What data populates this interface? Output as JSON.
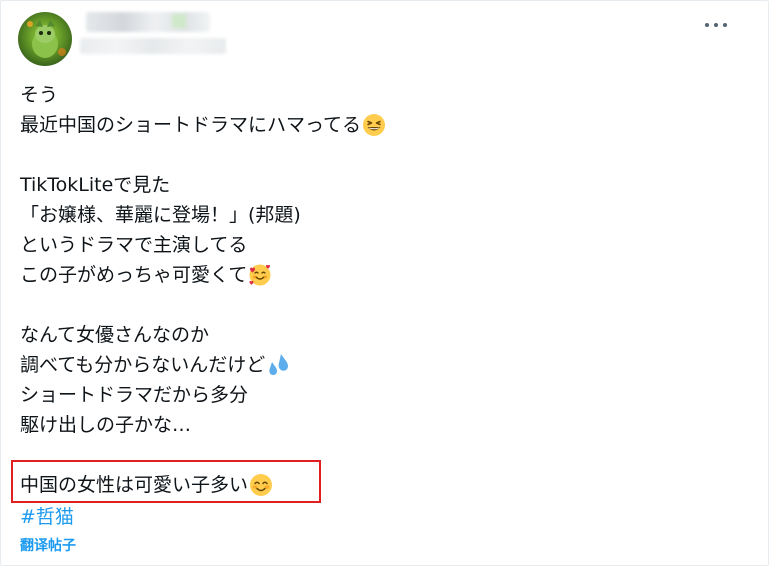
{
  "post": {
    "lines": [
      {
        "text": "そう"
      },
      {
        "text": "最近中国のショートドラマにハマってる",
        "emoji": "grinning-squinting-face-emoji"
      },
      {
        "text": ""
      },
      {
        "text": "TikTokLiteで見た"
      },
      {
        "text": "「お嬢様、華麗に登場！」(邦題)"
      },
      {
        "text": "というドラマで主演してる"
      },
      {
        "text": "この子がめっちゃ可愛くて",
        "emoji": "smiling-face-with-hearts-emoji"
      },
      {
        "text": ""
      },
      {
        "text": "なんて女優さんなのか"
      },
      {
        "text": "調べても分からないんだけど",
        "emoji": "sweat-droplets-emoji"
      },
      {
        "text": "ショートドラマだから多分"
      },
      {
        "text": "駆け出しの子かな…"
      },
      {
        "text": ""
      },
      {
        "text": "中国の女性は可愛い子多い",
        "emoji": "smiling-face-with-smiling-eyes-emoji"
      }
    ],
    "hashtag": "#哲猫",
    "translate_label": "翻译帖子"
  },
  "icons": {
    "more": "more-options-icon"
  },
  "colors": {
    "link": "#1d9bf0",
    "text": "#0f1419",
    "highlight_border": "#e02020"
  }
}
